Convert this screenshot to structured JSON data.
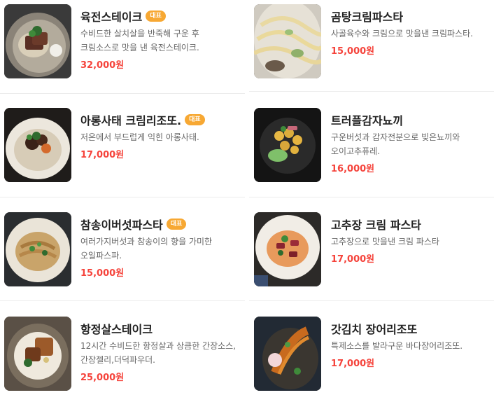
{
  "menu": {
    "items": [
      {
        "name": "육전스테이크",
        "badge": "대표",
        "description": "수비드한 살치살을 반죽해 구운 후 크림소스로 맛을 낸 육전스테이크.",
        "price": "32,000원",
        "image": "yukjeon-steak-photo"
      },
      {
        "name": "곰탕크림파스타",
        "badge": "",
        "description": "사골육수와 크림으로 맛을낸 크림파스타.",
        "price": "15,000원",
        "image": "gomtang-cream-pasta-photo"
      },
      {
        "name": "아롱사태 크림리조또.",
        "badge": "대표",
        "description": "저온에서 부드럽게 익힌 아롱사태.",
        "price": "17,000원",
        "image": "arong-satae-risotto-photo"
      },
      {
        "name": "트러플감자뇨끼",
        "badge": "",
        "description": "구운버섯과 감자전분으로 빚은뇨끼와 오이고추퓨레.",
        "price": "16,000원",
        "image": "truffle-potato-gnocchi-photo"
      },
      {
        "name": "참송이버섯파스타",
        "badge": "대표",
        "description": "여러가지버섯과 참송이의 향을 가미한 오일파스파.",
        "price": "15,000원",
        "image": "mushroom-oil-pasta-photo"
      },
      {
        "name": "고추장 크림 파스타",
        "badge": "",
        "description": "고추장으로 맛을낸 크림 파스타",
        "price": "17,000원",
        "image": "gochujang-cream-pasta-photo"
      },
      {
        "name": "항정살스테이크",
        "badge": "",
        "description": "12시간 수비드한 항정살과 상큼한 간장소스,간장젤리,더덕파우더.",
        "price": "25,000원",
        "image": "pork-jowl-steak-photo"
      },
      {
        "name": "갓김치 장어리조또",
        "badge": "",
        "description": "특제소스를 발라구운 바다장어리조또.",
        "price": "17,000원",
        "image": "eel-risotto-photo"
      }
    ]
  },
  "colors": {
    "price": "#f5433b",
    "badge": "#f7a833",
    "name": "#222222",
    "description": "#666666"
  }
}
